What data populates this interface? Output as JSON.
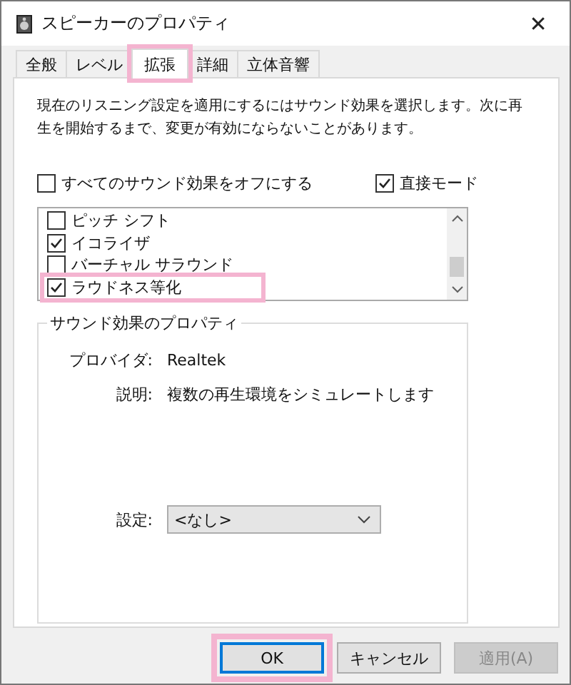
{
  "window": {
    "title": "スピーカーのプロパティ",
    "close": "✕"
  },
  "tabs": [
    {
      "label": "全般",
      "selected": false,
      "highlighted": false
    },
    {
      "label": "レベル",
      "selected": false,
      "highlighted": false
    },
    {
      "label": "拡張",
      "selected": true,
      "highlighted": true
    },
    {
      "label": "詳細",
      "selected": false,
      "highlighted": false
    },
    {
      "label": "立体音響",
      "selected": false,
      "highlighted": false
    }
  ],
  "intro": "現在のリスニング設定を適用にするにはサウンド効果を選択します。次に再生を開始するまで、変更が有効にならないことがあります。",
  "options": [
    {
      "label": "すべてのサウンド効果をオフにする",
      "checked": false
    },
    {
      "label": "直接モード",
      "checked": true
    }
  ],
  "effects": [
    {
      "label": "ピッチ シフト",
      "checked": false,
      "highlighted": false
    },
    {
      "label": "イコライザ",
      "checked": true,
      "highlighted": false
    },
    {
      "label": "バーチャル サラウンド",
      "checked": false,
      "highlighted": false
    },
    {
      "label": "ラウドネス等化",
      "checked": true,
      "highlighted": true
    }
  ],
  "properties": {
    "title": "サウンド効果のプロパティ",
    "provider_label": "プロバイダ:",
    "provider": "Realtek",
    "description_label": "説明:",
    "description": "複数の再生環境をシミュレートします",
    "setting_label": "設定:",
    "setting": "<なし>"
  },
  "buttons": [
    {
      "label": "OK",
      "disabled": false,
      "highlighted": true
    },
    {
      "label": "キャンセル",
      "disabled": false,
      "highlighted": false
    },
    {
      "label": "適用(A)",
      "disabled": true,
      "highlighted": false
    }
  ]
}
